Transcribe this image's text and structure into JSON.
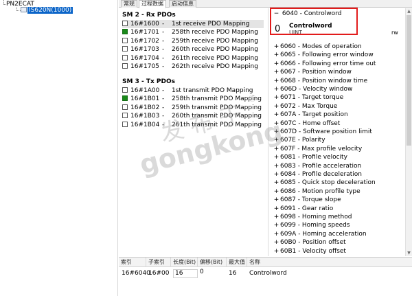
{
  "tree": {
    "root_label": "PN2ECAT",
    "device_label": "IS620N(1000)"
  },
  "tabs": [
    {
      "label": "常规"
    },
    {
      "label": "过程数据"
    },
    {
      "label": "启动信息"
    }
  ],
  "pdo": {
    "sm2_title": "SM 2 - Rx PDOs",
    "sm2_rows": [
      {
        "index": "16#1600",
        "name": "1st receive PDO Mapping",
        "checked": false,
        "selected": true
      },
      {
        "index": "16#1701",
        "name": "258th receive PDO Mapping",
        "checked": true,
        "selected": false
      },
      {
        "index": "16#1702",
        "name": "259th receive PDO Mapping",
        "checked": false,
        "selected": false
      },
      {
        "index": "16#1703",
        "name": "260th receive PDO Mapping",
        "checked": false,
        "selected": false
      },
      {
        "index": "16#1704",
        "name": "261th receive PDO Mapping",
        "checked": false,
        "selected": false
      },
      {
        "index": "16#1705",
        "name": "262th receive PDO Mapping",
        "checked": false,
        "selected": false
      }
    ],
    "sm3_title": "SM 3 - Tx PDOs",
    "sm3_rows": [
      {
        "index": "16#1A00",
        "name": "1st transmit PDO Mapping",
        "checked": false,
        "selected": false
      },
      {
        "index": "16#1B01",
        "name": "258th transmit PDO Mapping",
        "checked": true,
        "selected": false
      },
      {
        "index": "16#1B02",
        "name": "259th transmit PDO Mapping",
        "checked": false,
        "selected": false
      },
      {
        "index": "16#1B03",
        "name": "260th transmit PDO Mapping",
        "checked": false,
        "selected": false
      },
      {
        "index": "16#1B04",
        "name": "261th transmit PDO Mapping",
        "checked": false,
        "selected": false
      }
    ],
    "dash": "-"
  },
  "objects": {
    "expanded": {
      "toggle": "−",
      "title": "6040 - Controlword",
      "sub_index": "0",
      "sub_name": "Controlword",
      "sub_type": "UINT",
      "access": "rw"
    },
    "items": [
      "6060 - Modes of operation",
      "6065 - Following error window",
      "6066 - Following error time out",
      "6067 - Position window",
      "6068 - Position window time",
      "606D - Velocity window",
      "6071 - Target torque",
      "6072 - Max Torque",
      "607A - Target position",
      "607C - Home offset",
      "607D - Software position limit",
      "607E - Polarity",
      "607F - Max profile velocity",
      "6081 - Profile velocity",
      "6083 - Profile acceleration",
      "6084 - Profile deceleration",
      "6085 - Quick stop deceleration",
      "6086 - Motion profile type",
      "6087 - Torque slope",
      "6091 - Gear ratio",
      "6098 - Homing method",
      "6099 - Homing speeds",
      "609A - Homing acceleration",
      "60B0 - Position offset",
      "60B1 - Velocity offset"
    ],
    "toggle_collapsed": "+"
  },
  "grid": {
    "headers": [
      "索引",
      "子索引",
      "长度(Bit)",
      "偏移(Bit)",
      "最大值",
      "名称"
    ],
    "row": [
      "16#6040",
      "16#00",
      "16",
      "0",
      "16",
      "Controlword"
    ]
  },
  "watermark": {
    "cn": "发布于",
    "en": "gongkong",
    "reg": "®"
  }
}
